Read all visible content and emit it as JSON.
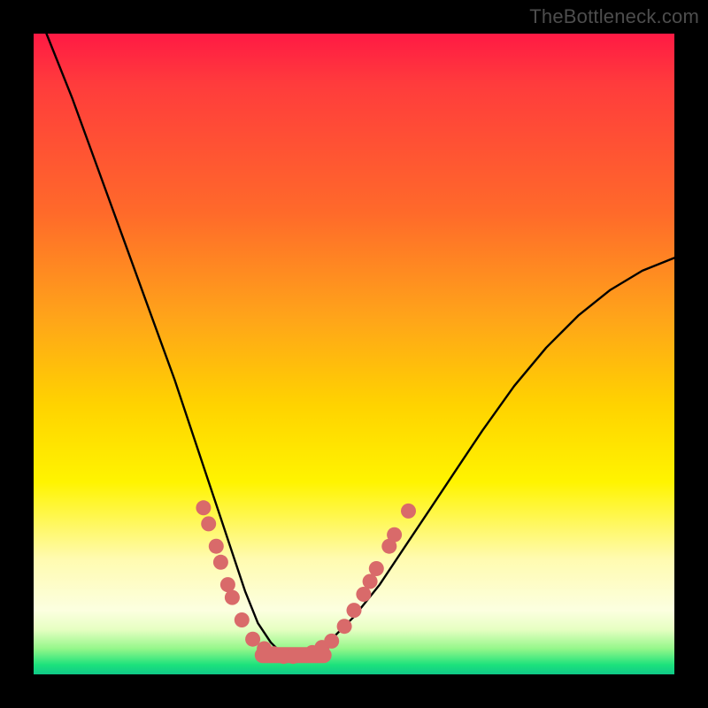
{
  "watermark": "TheBottleneck.com",
  "chart_data": {
    "type": "line",
    "title": "",
    "xlabel": "",
    "ylabel": "",
    "xlim": [
      0,
      100
    ],
    "ylim": [
      0,
      100
    ],
    "series": [
      {
        "name": "bottleneck-curve",
        "x": [
          2,
          6,
          10,
          14,
          18,
          22,
          25,
          27,
          29,
          31,
          33,
          35,
          37,
          39,
          41,
          43,
          46,
          50,
          54,
          58,
          62,
          66,
          70,
          75,
          80,
          85,
          90,
          95,
          100
        ],
        "y": [
          100,
          90,
          79,
          68,
          57,
          46,
          37,
          31,
          25,
          19,
          13,
          8,
          5,
          3,
          2.5,
          3,
          5,
          9,
          14,
          20,
          26,
          32,
          38,
          45,
          51,
          56,
          60,
          63,
          65
        ]
      }
    ],
    "markers": {
      "name": "marker-dots",
      "color": "#d96a6a",
      "points": [
        {
          "x": 26.5,
          "y": 26
        },
        {
          "x": 27.3,
          "y": 23.5
        },
        {
          "x": 28.5,
          "y": 20
        },
        {
          "x": 29.2,
          "y": 17.5
        },
        {
          "x": 30.3,
          "y": 14
        },
        {
          "x": 31.0,
          "y": 12
        },
        {
          "x": 32.5,
          "y": 8.5
        },
        {
          "x": 34.2,
          "y": 5.5
        },
        {
          "x": 36.0,
          "y": 4.0
        },
        {
          "x": 37.5,
          "y": 3.2
        },
        {
          "x": 39.0,
          "y": 2.8
        },
        {
          "x": 40.5,
          "y": 2.8
        },
        {
          "x": 42.0,
          "y": 3.0
        },
        {
          "x": 43.5,
          "y": 3.4
        },
        {
          "x": 45.0,
          "y": 4.2
        },
        {
          "x": 46.5,
          "y": 5.2
        },
        {
          "x": 48.5,
          "y": 7.5
        },
        {
          "x": 50.0,
          "y": 10.0
        },
        {
          "x": 51.5,
          "y": 12.5
        },
        {
          "x": 52.5,
          "y": 14.5
        },
        {
          "x": 53.5,
          "y": 16.5
        },
        {
          "x": 55.5,
          "y": 20.0
        },
        {
          "x": 56.3,
          "y": 21.8
        },
        {
          "x": 58.5,
          "y": 25.5
        }
      ]
    },
    "marker_pill": {
      "color": "#d96a6a",
      "x1": 34.5,
      "x2": 46.5,
      "y": 3.0,
      "height": 2.5
    }
  }
}
